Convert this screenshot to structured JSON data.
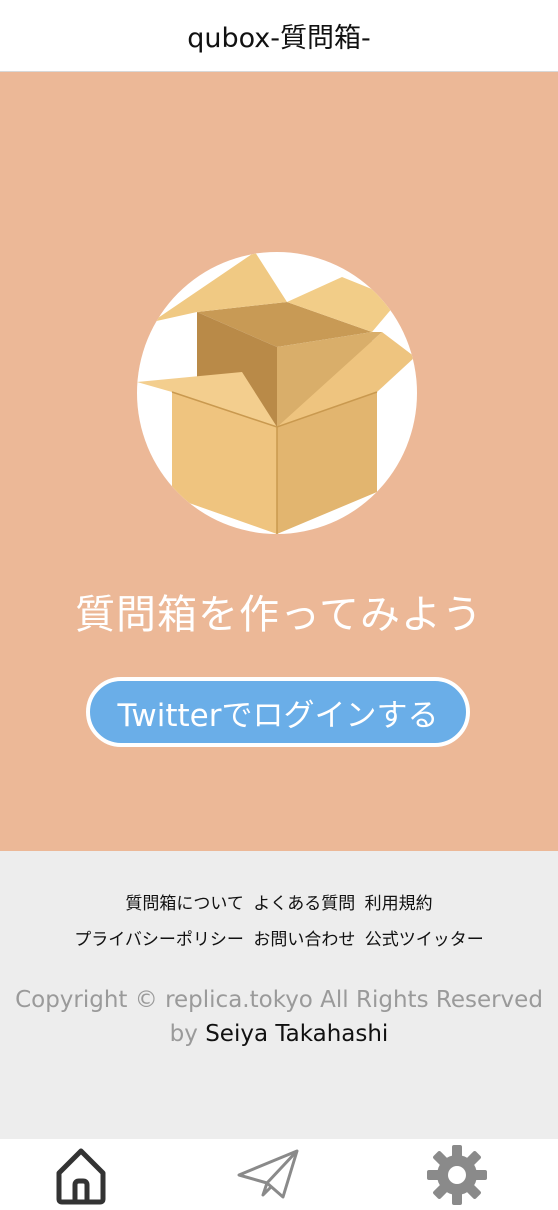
{
  "header": {
    "title": "qubox-質問箱-"
  },
  "hero": {
    "title": "質問箱を作ってみよう",
    "login_button": "Twitterでログインする",
    "accent_color": "#ecb897",
    "button_color": "#6aaee8"
  },
  "footer": {
    "links_row1": [
      "質問箱について",
      "よくある質問",
      "利用規約"
    ],
    "links_row2": [
      "プライバシーポリシー",
      "お問い合わせ",
      "公式ツイッター"
    ],
    "copyright": "Copyright © replica.tokyo All Rights Reserved",
    "by_label": "by",
    "author": "Seiya Takahashi"
  },
  "tabbar": {
    "items": [
      {
        "icon": "home-icon"
      },
      {
        "icon": "paper-plane-icon"
      },
      {
        "icon": "gear-icon"
      }
    ]
  }
}
